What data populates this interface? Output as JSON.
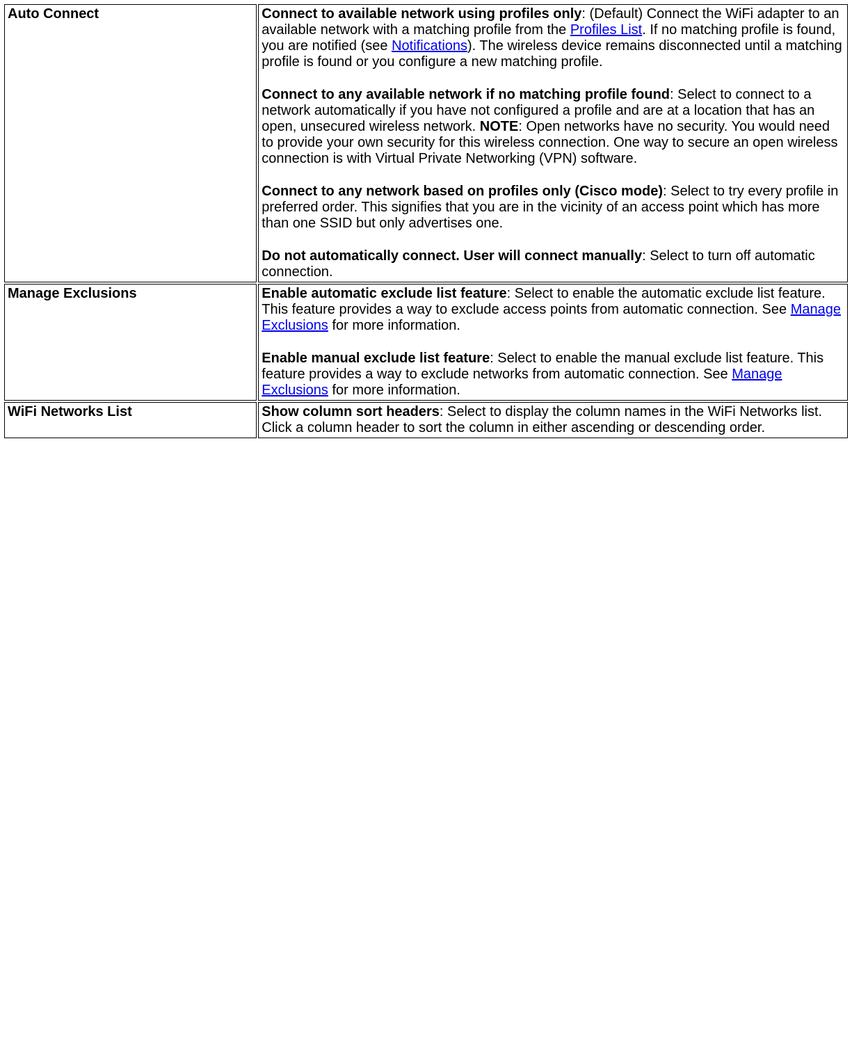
{
  "rows": {
    "autoConnect": {
      "header": "Auto Connect",
      "p1": {
        "bold": "Connect to available network using profiles only",
        "t1": ": (Default) Connect the WiFi adapter to an available network with a matching profile from the ",
        "link1": "Profiles List",
        "t2": ". If no matching profile is found, you are notified (see ",
        "link2": "Notifications",
        "t3": "). The wireless device remains disconnected until a matching profile is found or you configure a new matching profile."
      },
      "p2": {
        "bold1": "Connect to any available network if no matching profile found",
        "t1": ": Select to connect to a network automatically if you have not configured a profile and are at a location that has an open, unsecured wireless network. ",
        "bold2": "NOTE",
        "t2": ": Open networks have no security. You would need to provide your own security for this wireless connection. One way to secure an open wireless connection is with Virtual Private Networking (VPN) software."
      },
      "p3": {
        "bold": "Connect to any network based on profiles only (Cisco mode)",
        "t1": ": Select to try every profile in preferred order. This signifies that you are in the vicinity of an access point which has more than one SSID but only advertises one."
      },
      "p4": {
        "bold": "Do not automatically connect. User will connect manually",
        "t1": ": Select to turn off automatic connection."
      }
    },
    "manageExclusions": {
      "header": "Manage Exclusions",
      "p1": {
        "bold": "Enable automatic exclude list feature",
        "t1": ": Select to enable the automatic exclude list feature. This feature provides a way to exclude access points from automatic connection. See ",
        "link1": "Manage Exclusions",
        "t2": " for more information."
      },
      "p2": {
        "bold": "Enable manual exclude list feature",
        "t1": ": Select to enable the manual exclude list feature. This feature provides a way to exclude networks from automatic connection. See ",
        "link1": "Manage Exclusions",
        "t2": " for more information."
      }
    },
    "wifiNetworks": {
      "header": "WiFi Networks List",
      "p1": {
        "bold": "Show column sort headers",
        "t1": ": Select to display the column names in the WiFi Networks list. Click a column header to sort the column in either ascending or descending order."
      }
    }
  }
}
